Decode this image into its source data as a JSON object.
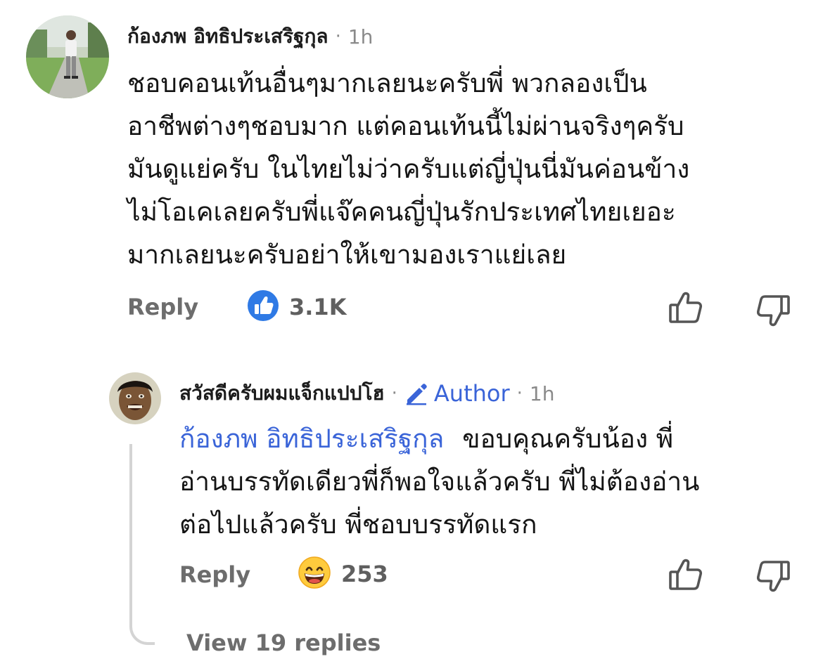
{
  "comment": {
    "author": "ก้องภพ อิทธิประเสริฐกุล",
    "separator": "·",
    "time": "1h",
    "lines": [
      "ชอบคอนเท้นอื่นๆมากเลยนะครับพี่ พวกลองเป็น",
      "อาชีพต่างๆชอบมาก แต่คอนเท้นนี้ไม่ผ่านจริงๆครับ",
      "มันดูแย่ครับ ในไทยไม่ว่าครับแต่ญี่ปุ่นนี่มันค่อนข้าง",
      "ไม่โอเคเลยครับพี่แจ๊คคนญี่ปุ่นรักประเทศไทยเยอะ",
      "มากเลยนะครับอย่าให้เขามองเราแย่เลย"
    ],
    "reply_label": "Reply",
    "reaction_icon": "like-icon",
    "reaction_count": "3.1K",
    "avatar_icon": "user-photo-avatar"
  },
  "reply": {
    "author": "สวัสดีครับผมแจ็กแปปโฮ",
    "separator": "·",
    "badge_icon": "pencil-icon",
    "badge_label": "Author",
    "separator2": "·",
    "time": "1h",
    "mention": "ก้องภพ อิทธิประเสริฐกุล",
    "line1_rest": "ขอบคุณครับน้อง พี่",
    "lines": [
      "อ่านบรรทัดเดียวพี่ก็พอใจแล้วครับ พี่ไม่ต้องอ่าน",
      "ต่อไปแล้วครับ พี่ชอบบรรทัดแรก"
    ],
    "reply_label": "Reply",
    "reaction_icon": "grinning-emoji-icon",
    "reaction_count": "253",
    "avatar_icon": "creator-face-avatar"
  },
  "view_replies": "View 19 replies",
  "colors": {
    "accent_blue": "#3a64d8",
    "muted_text": "#6d6d6d",
    "thread_line": "#d4d4d4"
  }
}
